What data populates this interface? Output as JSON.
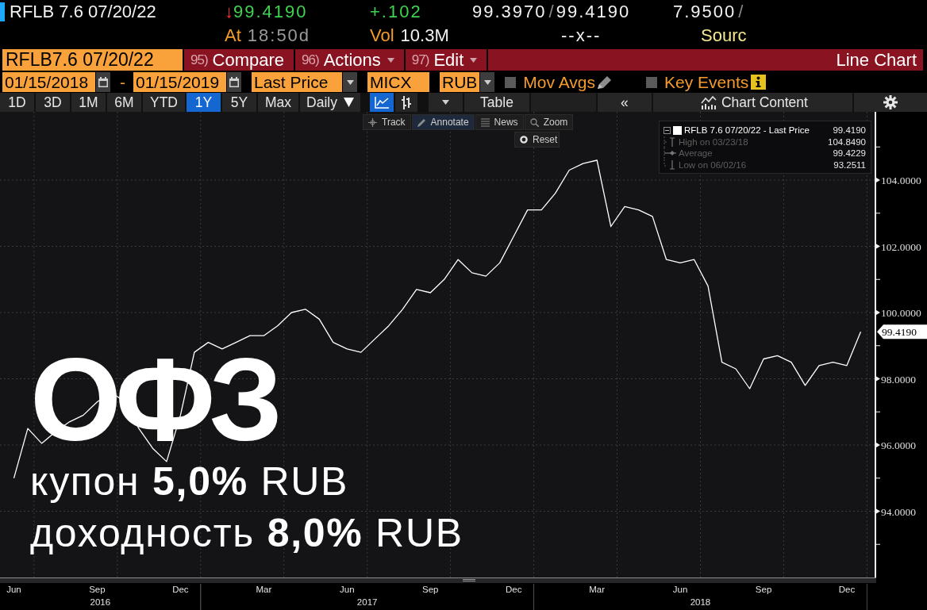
{
  "quote_header": {
    "ticker": "RFLB 7.6 07/20/22",
    "change_arrow": "↓",
    "last_price": "99.4190",
    "change": "+.102",
    "bid": "99.3970",
    "bid_ask_separator": "/",
    "ask": "99.4190",
    "yield": "7.9500",
    "yield_separator": "/",
    "time_label": "At",
    "time": "18:50d",
    "volume_label": "Vol",
    "volume": "10.3M",
    "size": "--x--",
    "source_label": "Sourc"
  },
  "function_bar": {
    "security": "RFLB7.6 07/20/22",
    "buttons": [
      {
        "number": "95)",
        "label": "Compare",
        "dropdown": false
      },
      {
        "number": "96)",
        "label": "Actions",
        "dropdown": true
      },
      {
        "number": "97)",
        "label": "Edit",
        "dropdown": true
      }
    ],
    "view_title": "Line Chart"
  },
  "settings_bar": {
    "start_date": "01/15/2018",
    "date_separator": "-",
    "end_date": "01/15/2019",
    "field": "Last Price",
    "exchange": "MICX",
    "currency": "RUB",
    "options": [
      {
        "kind": "edit",
        "label": "Mov Avgs",
        "checked": false
      },
      {
        "kind": "info",
        "label": "Key Events",
        "checked": false
      }
    ]
  },
  "range_bar": {
    "periods": [
      {
        "label": "1D",
        "selected": false
      },
      {
        "label": "3D",
        "selected": false
      },
      {
        "label": "1M",
        "selected": false
      },
      {
        "label": "6M",
        "selected": false
      },
      {
        "label": "YTD",
        "selected": false
      },
      {
        "label": "1Y",
        "selected": true
      },
      {
        "label": "5Y",
        "selected": false
      },
      {
        "label": "Max",
        "selected": false
      }
    ],
    "frequency": "Daily",
    "chart_types": [
      {
        "kind": "line",
        "selected": true
      },
      {
        "kind": "bars",
        "selected": false
      }
    ],
    "table_label": "Table",
    "collapse": "«",
    "panel_title": "Chart Content"
  },
  "chart": {
    "tools": [
      {
        "kind": "track",
        "label": "Track",
        "selected": false
      },
      {
        "kind": "annotate",
        "label": "Annotate",
        "selected": true
      },
      {
        "kind": "news",
        "label": "News",
        "selected": false
      },
      {
        "kind": "zoom",
        "label": "Zoom",
        "selected": false
      }
    ],
    "reset_label": "Reset",
    "legend": {
      "value": "99.4190",
      "rows": [
        {
          "kind": "high",
          "label": "High on 03/23/18",
          "value": "104.8490"
        },
        {
          "kind": "average",
          "label": "Average",
          "value": "99.4229"
        },
        {
          "kind": "low",
          "label": "Low on 06/02/16",
          "value": "93.2511"
        }
      ]
    },
    "overlay": {
      "title": "ОФЗ",
      "lines": [
        "купон **5,0%** RUB",
        "доходность **8,0%** RUB"
      ]
    },
    "last_price_tag": "99.4190",
    "x_axis_years": [
      "2016",
      "2017",
      "2018"
    ],
    "chart_data": {
      "type": "line",
      "grid": true,
      "categories": [
        "Jun",
        null,
        null,
        null,
        null,
        null,
        "Sep",
        null,
        null,
        null,
        null,
        null,
        "Dec",
        null,
        null,
        null,
        null,
        null,
        "Mar",
        null,
        null,
        null,
        null,
        null,
        "Jun",
        null,
        null,
        null,
        null,
        null,
        "Sep",
        null,
        null,
        null,
        null,
        null,
        "Dec",
        null,
        null,
        null,
        null,
        null,
        "Mar",
        null,
        null,
        null,
        null,
        null,
        "Jun",
        null,
        null,
        null,
        null,
        null,
        "Sep",
        null,
        null,
        null,
        null,
        null,
        "Dec",
        null
      ],
      "series": [
        {
          "name": "RFLB 7.6 07/20/22 - Last Price",
          "color": "#ffffff",
          "values": [
            95.0,
            96.5,
            96.05,
            96.4,
            96.7,
            96.9,
            97.3,
            97.6,
            97.3,
            96.5,
            95.9,
            95.5,
            96.9,
            98.8,
            99.1,
            98.9,
            99.1,
            99.3,
            99.3,
            99.6,
            100.0,
            100.1,
            99.8,
            99.1,
            98.9,
            98.8,
            99.2,
            99.6,
            100.1,
            100.7,
            100.6,
            101.0,
            101.6,
            101.2,
            101.1,
            101.5,
            102.3,
            103.1,
            103.1,
            103.6,
            104.3,
            104.5,
            104.6,
            102.6,
            103.2,
            103.1,
            102.9,
            101.6,
            101.5,
            101.6,
            100.8,
            98.5,
            98.3,
            97.7,
            98.6,
            98.7,
            98.5,
            97.8,
            98.4,
            98.5,
            98.4,
            99.42
          ]
        }
      ],
      "ylim": [
        92,
        106.06
      ],
      "yticks": [
        {
          "value": 94,
          "label": "94.0000"
        },
        {
          "value": 96,
          "label": "96.0000"
        },
        {
          "value": 98,
          "label": "98.0000"
        },
        {
          "value": 100,
          "label": "100.0000"
        },
        {
          "value": 102,
          "label": "102.0000"
        },
        {
          "value": 104,
          "label": "104.0000"
        }
      ]
    }
  }
}
